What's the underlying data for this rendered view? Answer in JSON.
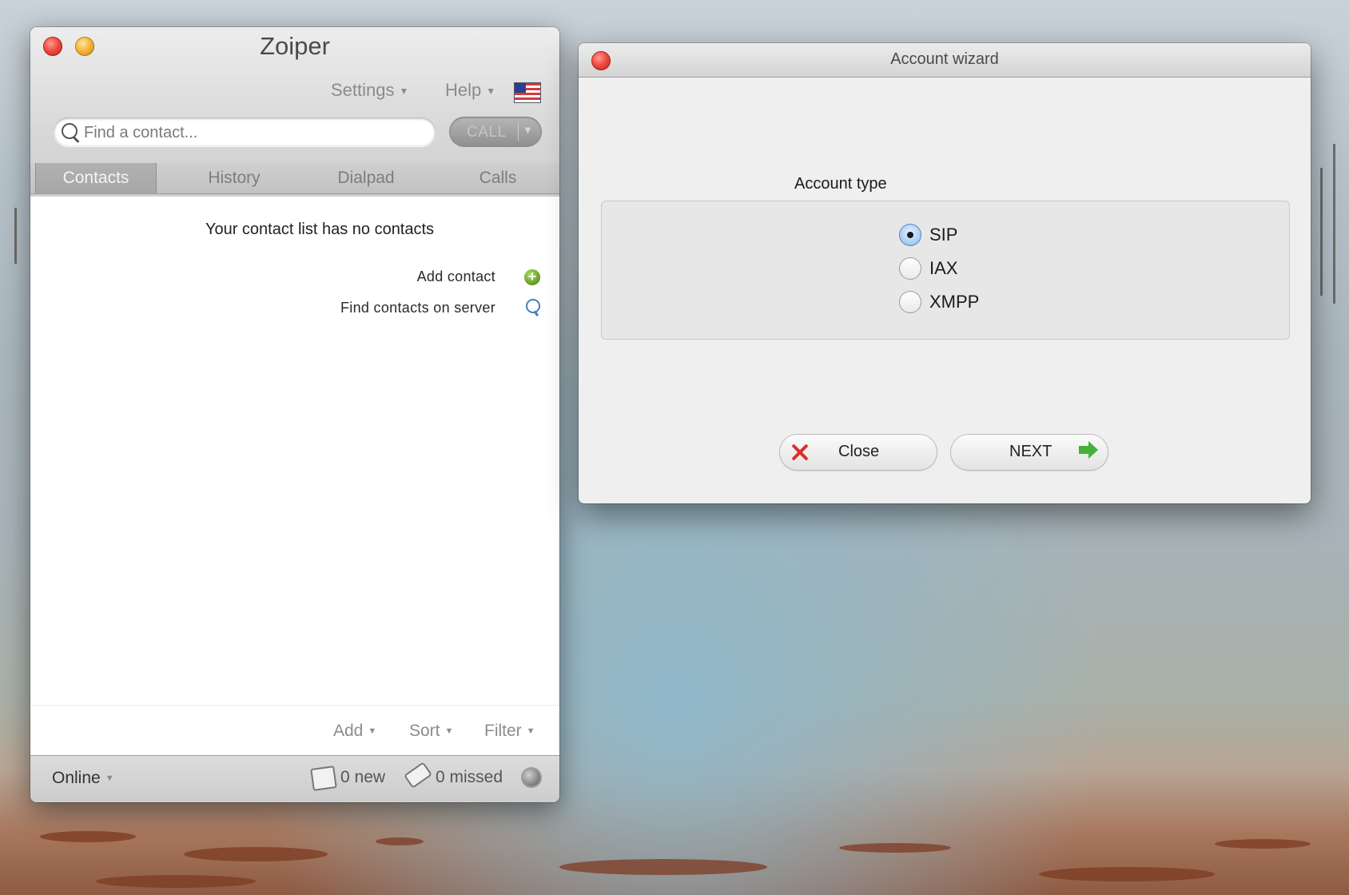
{
  "zoiper": {
    "title": "Zoiper",
    "menu": {
      "settings": "Settings",
      "help": "Help"
    },
    "search": {
      "placeholder": "Find a contact...",
      "value": ""
    },
    "call_button": "CALL",
    "tabs": [
      {
        "label": "Contacts",
        "active": true
      },
      {
        "label": "History",
        "active": false
      },
      {
        "label": "Dialpad",
        "active": false
      },
      {
        "label": "Calls",
        "active": false
      }
    ],
    "empty_message": "Your contact list has no contacts",
    "add_contact": "Add contact",
    "find_contacts": "Find contacts on server",
    "bottom_menu": {
      "add": "Add",
      "sort": "Sort",
      "filter": "Filter"
    },
    "status": {
      "presence": "Online",
      "new_messages": "0 new",
      "missed_calls": "0 missed"
    }
  },
  "wizard": {
    "title": "Account wizard",
    "account_type_label": "Account type",
    "options": [
      {
        "label": "SIP",
        "selected": true
      },
      {
        "label": "IAX",
        "selected": false
      },
      {
        "label": "XMPP",
        "selected": false
      }
    ],
    "close_button": "Close",
    "next_button": "NEXT"
  },
  "colors": {
    "close_icon": "#d8302a",
    "next_arrow": "#46b13a",
    "add_icon": "#5a9a1c",
    "search_icon": "#4a7db8"
  },
  "icons": {
    "close": "close-icon",
    "minimize": "minimize-icon",
    "flag": "flag-icon",
    "search": "search-icon",
    "add": "add-icon",
    "find": "magnifier-icon",
    "messages": "message-icon",
    "missed": "missed-call-icon",
    "globe": "globe-icon",
    "next": "arrow-right-icon"
  }
}
